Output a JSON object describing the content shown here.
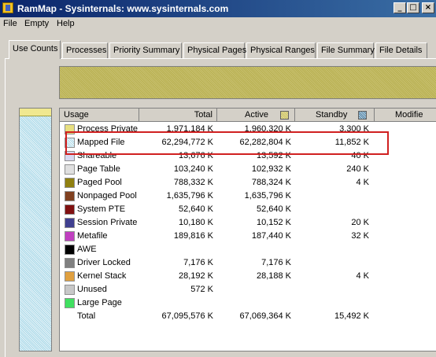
{
  "window": {
    "title": "RamMap - Sysinternals: www.sysinternals.com",
    "controls": [
      "_",
      "□",
      "×"
    ]
  },
  "menu": [
    "File",
    "Empty",
    "Help"
  ],
  "tabs": [
    {
      "label": "Use Counts",
      "active": true
    },
    {
      "label": "Processes"
    },
    {
      "label": "Priority Summary"
    },
    {
      "label": "Physical Pages"
    },
    {
      "label": "Physical Ranges"
    },
    {
      "label": "File Summary"
    },
    {
      "label": "File Details"
    }
  ],
  "table": {
    "headers": {
      "usage": "Usage",
      "total": "Total",
      "active": "Active",
      "standby": "Standby",
      "modified": "Modifie"
    },
    "rows": [
      {
        "name": "Process Private",
        "total": "1,971,184 K",
        "active": "1,960,320 K",
        "standby": "3,300 K",
        "color": "#e8e080"
      },
      {
        "name": "Mapped File",
        "total": "62,294,772 K",
        "active": "62,282,804 K",
        "standby": "11,852 K",
        "color": "#a8d8e8"
      },
      {
        "name": "Shareable",
        "total": "13,676 K",
        "active": "13,592 K",
        "standby": "40 K",
        "color": "#d8d8f0"
      },
      {
        "name": "Page Table",
        "total": "103,240 K",
        "active": "102,932 K",
        "standby": "240 K",
        "color": "#e0e0e0"
      },
      {
        "name": "Paged Pool",
        "total": "788,332 K",
        "active": "788,324 K",
        "standby": "4 K",
        "color": "#908010"
      },
      {
        "name": "Nonpaged Pool",
        "total": "1,635,796 K",
        "active": "1,635,796 K",
        "standby": "",
        "color": "#804020"
      },
      {
        "name": "System PTE",
        "total": "52,640 K",
        "active": "52,640 K",
        "standby": "",
        "color": "#801010"
      },
      {
        "name": "Session Private",
        "total": "10,180 K",
        "active": "10,152 K",
        "standby": "20 K",
        "color": "#404090"
      },
      {
        "name": "Metafile",
        "total": "189,816 K",
        "active": "187,440 K",
        "standby": "32 K",
        "color": "#c040c0"
      },
      {
        "name": "AWE",
        "total": "",
        "active": "",
        "standby": "",
        "color": "#000000"
      },
      {
        "name": "Driver Locked",
        "total": "7,176 K",
        "active": "7,176 K",
        "standby": "",
        "color": "#808080"
      },
      {
        "name": "Kernel Stack",
        "total": "28,192 K",
        "active": "28,188 K",
        "standby": "4 K",
        "color": "#e0a040"
      },
      {
        "name": "Unused",
        "total": "572 K",
        "active": "",
        "standby": "",
        "color": "#c8c8c8"
      },
      {
        "name": "Large Page",
        "total": "",
        "active": "",
        "standby": "",
        "color": "#40e060"
      },
      {
        "name": "Total",
        "total": "67,095,576 K",
        "active": "67,069,364 K",
        "standby": "15,492 K",
        "color": ""
      }
    ]
  },
  "colors": {
    "titlebar_start": "#0a246a",
    "titlebar_end": "#3a6ea5",
    "highlight": "#d02020",
    "face": "#d4d0c8"
  }
}
